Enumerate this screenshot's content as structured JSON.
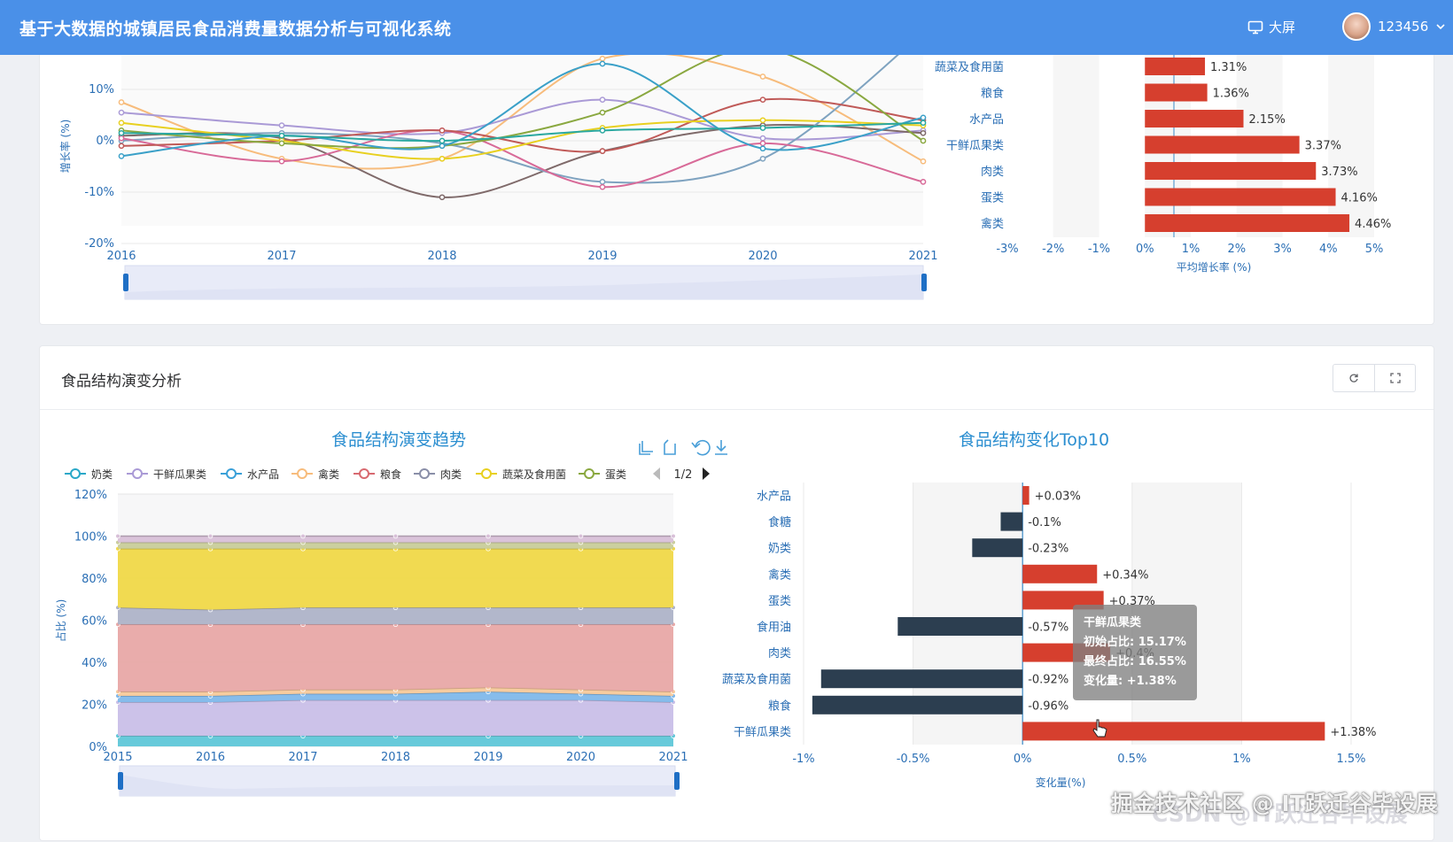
{
  "header": {
    "app_title": "基于大数据的城镇居民食品消费量数据分析与可视化系统",
    "bigscreen_label": "大屏",
    "username": "123456"
  },
  "section2": {
    "title": "食品结构演变分析"
  },
  "colors": {
    "red": "#d63f2e",
    "navy": "#2c3e50",
    "header": "#4a90e8"
  },
  "growth_line_chart": {
    "ylabel": "增长率 (%)",
    "y_ticks": [
      "10%",
      "0%",
      "-10%",
      "-20%"
    ],
    "x_ticks": [
      "2016",
      "2017",
      "2018",
      "2019",
      "2020",
      "2021"
    ]
  },
  "avg_growth_chart": {
    "xlabel": "平均增长率 (%)",
    "x_ticks": [
      "-3%",
      "-2%",
      "-1%",
      "0%",
      "1%",
      "2%",
      "3%",
      "4%",
      "5%"
    ]
  },
  "structure_trend_chart": {
    "title": "食品结构演变趋势",
    "ylabel": "占比 (%)",
    "y_ticks": [
      "120%",
      "100%",
      "80%",
      "60%",
      "40%",
      "20%",
      "0%"
    ],
    "x_ticks": [
      "2015",
      "2016",
      "2017",
      "2018",
      "2019",
      "2020",
      "2021"
    ],
    "legend": [
      "奶类",
      "干鲜瓜果类",
      "水产品",
      "禽类",
      "粮食",
      "肉类",
      "蔬菜及食用菌",
      "蛋类"
    ],
    "legend_page": "1/2"
  },
  "top10_chart": {
    "title": "食品结构变化Top10",
    "xlabel": "变化量(%)",
    "x_ticks": [
      "-1%",
      "-0.5%",
      "0%",
      "0.5%",
      "1%",
      "1.5%"
    ]
  },
  "tooltip": {
    "name": "干鲜瓜果类",
    "line1": "初始占比: 15.17%",
    "line2": "最终占比: 16.55%",
    "line3": "变化量: +1.38%"
  },
  "watermark": "掘金技术社区 @ IT跃迁谷毕设展",
  "watermark_csdn": "CSDN @IT跃迁谷毕设展",
  "chart_data": [
    {
      "type": "bar",
      "orientation": "horizontal",
      "categories": [
        "蔬菜及食用菌",
        "粮食",
        "水产品",
        "干鲜瓜果类",
        "肉类",
        "蛋类",
        "禽类"
      ],
      "values": [
        1.31,
        1.36,
        2.15,
        3.37,
        3.73,
        4.16,
        4.46
      ],
      "value_labels": [
        "1.31%",
        "1.36%",
        "2.15%",
        "3.37%",
        "3.73%",
        "4.16%",
        "4.46%"
      ],
      "xlabel": "平均增长率 (%)",
      "xlim": [
        -3,
        5
      ]
    },
    {
      "type": "bar",
      "orientation": "horizontal",
      "title": "食品结构变化Top10",
      "categories": [
        "水产品",
        "食糖",
        "奶类",
        "禽类",
        "蛋类",
        "食用油",
        "肉类",
        "蔬菜及食用菌",
        "粮食",
        "干鲜瓜果类"
      ],
      "values": [
        0.03,
        -0.1,
        -0.23,
        0.34,
        0.37,
        -0.57,
        0.4,
        -0.92,
        -0.96,
        1.38
      ],
      "value_labels": [
        "+0.03%",
        "-0.1%",
        "-0.23%",
        "+0.34%",
        "+0.37%",
        "-0.57%",
        "+0.4%",
        "-0.92%",
        "-0.96%",
        "+1.38%"
      ],
      "xlabel": "变化量(%)",
      "xlim": [
        -1,
        1.5
      ]
    },
    {
      "type": "area",
      "stacked": true,
      "title": "食品结构演变趋势",
      "ylabel": "占比 (%)",
      "x": [
        "2015",
        "2016",
        "2017",
        "2018",
        "2019",
        "2020",
        "2021"
      ],
      "ylim": [
        0,
        120
      ],
      "bands": [
        {
          "color": "#5fc7d8",
          "values": [
            5,
            5,
            5,
            5,
            5,
            5,
            5
          ]
        },
        {
          "color": "#c9bfe8",
          "values": [
            16,
            16,
            17,
            17,
            17,
            17,
            16
          ]
        },
        {
          "color": "#7fb8ea",
          "values": [
            3,
            3,
            3,
            3,
            4,
            3,
            3
          ]
        },
        {
          "color": "#f7c99a",
          "values": [
            2,
            2,
            2,
            2,
            2,
            2,
            2
          ]
        },
        {
          "color": "#e8a8a6",
          "values": [
            32,
            32,
            31,
            31,
            30,
            31,
            32
          ]
        },
        {
          "color": "#aeb3c8",
          "values": [
            8,
            7,
            8,
            8,
            8,
            8,
            8
          ]
        },
        {
          "color": "#f0d848",
          "values": [
            28,
            29,
            28,
            28,
            28,
            28,
            28
          ]
        },
        {
          "color": "#c8cc9a",
          "values": [
            3,
            3,
            3,
            3,
            3,
            3,
            3
          ]
        },
        {
          "color": "#d8c0d8",
          "values": [
            3,
            3,
            3,
            3,
            3,
            3,
            3
          ]
        }
      ]
    },
    {
      "type": "line",
      "ylabel": "增长率 (%)",
      "x": [
        "2016",
        "2017",
        "2018",
        "2019",
        "2020",
        "2021"
      ],
      "ylim": [
        -20,
        10
      ],
      "series": [
        {
          "color": "#f7bc7c",
          "values": [
            7.5,
            -3.5,
            -3.5,
            16,
            12.5,
            -4
          ]
        },
        {
          "color": "#aa9ad6",
          "values": [
            5.5,
            3,
            1.5,
            8,
            0.5,
            2
          ]
        },
        {
          "color": "#7f6a6a",
          "values": [
            1,
            0.5,
            -11,
            -2,
            3,
            1.5
          ]
        },
        {
          "color": "#7fa3c0",
          "values": [
            0,
            1.5,
            -0.5,
            -8,
            -3.5,
            21
          ]
        },
        {
          "color": "#d86a98",
          "values": [
            0.5,
            -4,
            2,
            -9,
            -0.5,
            -8
          ]
        },
        {
          "color": "#c05a58",
          "values": [
            -1,
            0,
            2,
            -2,
            8,
            4
          ]
        },
        {
          "color": "#e8d020",
          "values": [
            3.5,
            0,
            -3.5,
            2.5,
            4,
            3
          ]
        },
        {
          "color": "#8aa840",
          "values": [
            2,
            -0.5,
            -1,
            5.5,
            18,
            0
          ]
        },
        {
          "color": "#3aa0c8",
          "values": [
            -3,
            1,
            -1,
            15,
            -1.5,
            4.5
          ]
        },
        {
          "color": "#2aa8a0",
          "values": [
            1.5,
            1,
            0,
            2,
            2.5,
            3.5
          ]
        }
      ]
    }
  ]
}
